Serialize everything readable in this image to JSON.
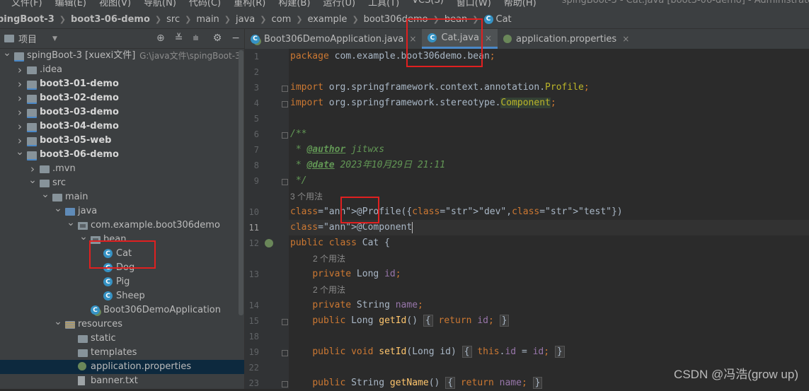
{
  "menubar": {
    "items": [
      "文件(F)",
      "编辑(E)",
      "视图(V)",
      "导航(N)",
      "代码(C)",
      "重构(R)",
      "构建(B)",
      "运行(U)",
      "工具(T)",
      "VCS(S)",
      "窗口(W)",
      "帮助(H)"
    ],
    "window_title": "spingBoot-3 - Cat.java [boot3-06-demo] - Administrator"
  },
  "breadcrumb": [
    "pingBoot-3",
    "boot3-06-demo",
    "src",
    "main",
    "java",
    "com",
    "example",
    "boot306demo",
    "bean",
    "Cat"
  ],
  "project_panel": {
    "title": "项目",
    "tree": [
      {
        "label": "spingBoot-3 [xuexi文件]",
        "extra": "G:\\java文件\\spingBoot-3",
        "depth": 0,
        "arrow": "down",
        "icon": "module-folder-icon",
        "bold": false
      },
      {
        "label": ".idea",
        "depth": 1,
        "arrow": "right",
        "icon": "folder-icon"
      },
      {
        "label": "boot3-01-demo",
        "depth": 1,
        "arrow": "right",
        "icon": "module-folder-icon",
        "bold": true
      },
      {
        "label": "boot3-02-demo",
        "depth": 1,
        "arrow": "right",
        "icon": "module-folder-icon",
        "bold": true
      },
      {
        "label": "boot3-03-demo",
        "depth": 1,
        "arrow": "right",
        "icon": "module-folder-icon",
        "bold": true
      },
      {
        "label": "boot3-04-demo",
        "depth": 1,
        "arrow": "right",
        "icon": "module-folder-icon",
        "bold": true
      },
      {
        "label": "boot3-05-web",
        "depth": 1,
        "arrow": "right",
        "icon": "module-folder-icon",
        "bold": true
      },
      {
        "label": "boot3-06-demo",
        "depth": 1,
        "arrow": "down",
        "icon": "module-folder-icon",
        "bold": true
      },
      {
        "label": ".mvn",
        "depth": 2,
        "arrow": "right",
        "icon": "folder-icon"
      },
      {
        "label": "src",
        "depth": 2,
        "arrow": "down",
        "icon": "folder-icon"
      },
      {
        "label": "main",
        "depth": 3,
        "arrow": "down",
        "icon": "folder-icon"
      },
      {
        "label": "java",
        "depth": 4,
        "arrow": "down",
        "icon": "source-folder-icon"
      },
      {
        "label": "com.example.boot306demo",
        "depth": 5,
        "arrow": "down",
        "icon": "package-icon"
      },
      {
        "label": "bean",
        "depth": 6,
        "arrow": "down",
        "icon": "package-icon"
      },
      {
        "label": "Cat",
        "depth": 7,
        "arrow": "",
        "icon": "class-icon"
      },
      {
        "label": "Dog",
        "depth": 7,
        "arrow": "",
        "icon": "class-icon"
      },
      {
        "label": "Pig",
        "depth": 7,
        "arrow": "",
        "icon": "class-icon"
      },
      {
        "label": "Sheep",
        "depth": 7,
        "arrow": "",
        "icon": "class-icon"
      },
      {
        "label": "Boot306DemoApplication",
        "depth": 6,
        "arrow": "",
        "icon": "spring-boot-class-icon"
      },
      {
        "label": "resources",
        "depth": 4,
        "arrow": "down",
        "icon": "resources-folder-icon"
      },
      {
        "label": "static",
        "depth": 5,
        "arrow": "",
        "icon": "folder-icon"
      },
      {
        "label": "templates",
        "depth": 5,
        "arrow": "",
        "icon": "folder-icon"
      },
      {
        "label": "application.properties",
        "depth": 5,
        "arrow": "",
        "icon": "properties-icon",
        "selected": true
      },
      {
        "label": "banner.txt",
        "depth": 5,
        "arrow": "",
        "icon": "text-file-icon"
      }
    ]
  },
  "tabs": [
    {
      "label": "Boot306DemoApplication.java",
      "icon": "spring-boot-class-icon",
      "active": false
    },
    {
      "label": "Cat.java",
      "icon": "class-icon",
      "active": true
    },
    {
      "label": "application.properties",
      "icon": "properties-icon",
      "active": false
    }
  ],
  "editor": {
    "current_line": "11",
    "lines": [
      {
        "n": "1",
        "text": "package com.example.boot306demo.bean;"
      },
      {
        "n": "2",
        "text": ""
      },
      {
        "n": "3",
        "text": "import org.springframework.context.annotation.Profile;"
      },
      {
        "n": "4",
        "text": "import org.springframework.stereotype.Component;"
      },
      {
        "n": "5",
        "text": ""
      },
      {
        "n": "6",
        "text": "/**"
      },
      {
        "n": "7",
        "text": " * @author jitwxs"
      },
      {
        "n": "8",
        "text": " * @date 2023年10月29日 21:11"
      },
      {
        "n": "9",
        "text": " */"
      },
      {
        "hint": "3 个用法"
      },
      {
        "n": "10",
        "text": "@Profile({\"dev\",\"test\"})"
      },
      {
        "n": "11",
        "text": "@Component"
      },
      {
        "n": "12",
        "text": "public class Cat {"
      },
      {
        "hint": "2 个用法"
      },
      {
        "n": "13",
        "text": "    private Long id;"
      },
      {
        "hint": "2 个用法"
      },
      {
        "n": "14",
        "text": "    private String name;"
      },
      {
        "n": "15",
        "text": "    public Long getId() { return id; }"
      },
      {
        "n": "18",
        "text": ""
      },
      {
        "n": "19",
        "text": "    public void setId(Long id) { this.id = id; }"
      },
      {
        "n": "22",
        "text": ""
      },
      {
        "n": "23",
        "text": "    public String getName() { return name; }"
      }
    ]
  },
  "watermark": "CSDN @冯浩(grow up)"
}
